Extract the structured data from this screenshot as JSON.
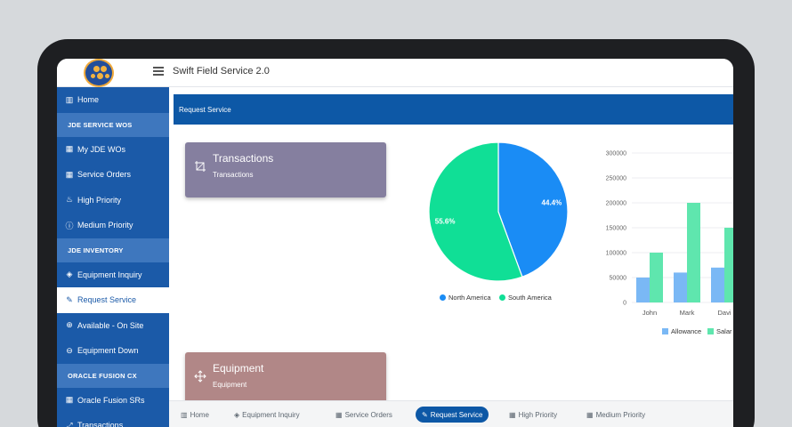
{
  "app": {
    "title": "Swift Field Service 2.0"
  },
  "sidebar": {
    "items": [
      {
        "type": "item",
        "label": "Home",
        "icon": "bar-chart-icon",
        "glyph": "▥"
      },
      {
        "type": "section",
        "label": "JDE SERVICE WOS"
      },
      {
        "type": "item",
        "label": "My JDE WOs",
        "icon": "grid-icon",
        "glyph": "▦"
      },
      {
        "type": "item",
        "label": "Service Orders",
        "icon": "grid-icon",
        "glyph": "▦"
      },
      {
        "type": "item",
        "label": "High Priority",
        "icon": "flame-icon",
        "glyph": "♨"
      },
      {
        "type": "item",
        "label": "Medium Priority",
        "icon": "alert-circle-icon",
        "glyph": "ⓘ"
      },
      {
        "type": "section",
        "label": "JDE INVENTORY"
      },
      {
        "type": "item",
        "label": "Equipment Inquiry",
        "icon": "layers-icon",
        "glyph": "◈"
      },
      {
        "type": "item",
        "label": "Request Service",
        "icon": "pencil-icon",
        "glyph": "✎",
        "active": true
      },
      {
        "type": "item",
        "label": "Available - On Site",
        "icon": "arrow-up-circle-icon",
        "glyph": "⊕"
      },
      {
        "type": "item",
        "label": "Equipment Down",
        "icon": "arrow-down-circle-icon",
        "glyph": "⊖"
      },
      {
        "type": "section",
        "label": "ORACLE FUSION CX"
      },
      {
        "type": "item",
        "label": "Oracle Fusion SRs",
        "icon": "grid-icon",
        "glyph": "▦"
      },
      {
        "type": "item",
        "label": "Transactions",
        "icon": "expand-icon",
        "glyph": "⤢"
      }
    ]
  },
  "content": {
    "header": "Request Service",
    "cards": [
      {
        "title": "Transactions",
        "subtitle": "Transactions",
        "color": "#857f9f",
        "icon": "crop-icon"
      },
      {
        "title": "Equipment",
        "subtitle": "Equipment",
        "color": "#b18787",
        "icon": "move-icon"
      }
    ]
  },
  "chart_data": [
    {
      "type": "pie",
      "slices": [
        {
          "label": "North America",
          "value": 44.4,
          "color": "#1a8cf5",
          "display": "44.4%"
        },
        {
          "label": "South America",
          "value": 55.6,
          "color": "#10df96",
          "display": "55.6%"
        }
      ],
      "legend": "bottom"
    },
    {
      "type": "bar",
      "categories": [
        "John",
        "Mark",
        "Davi"
      ],
      "series": [
        {
          "name": "Allowance",
          "values": [
            50000,
            60000,
            70000
          ],
          "color": "#7ab8f5"
        },
        {
          "name": "Salar",
          "values": [
            100000,
            200000,
            150000
          ],
          "color": "#5fe6ae"
        }
      ],
      "ylim": [
        0,
        300000
      ],
      "yticks": [
        "0",
        "50000",
        "100000",
        "150000",
        "200000",
        "250000",
        "300000"
      ],
      "grid": true,
      "legend": "bottom"
    }
  ],
  "bottomnav": {
    "items": [
      {
        "label": "Home",
        "glyph": "▥",
        "icon": "bar-chart-icon"
      },
      {
        "label": "Equipment Inquiry",
        "glyph": "◈",
        "icon": "layers-icon"
      },
      {
        "label": "Service Orders",
        "glyph": "▦",
        "icon": "grid-icon"
      },
      {
        "label": "Request Service",
        "glyph": "✎",
        "icon": "pencil-icon",
        "active": true
      },
      {
        "label": "High Priority",
        "glyph": "▦",
        "icon": "grid-icon"
      },
      {
        "label": "Medium Priority",
        "glyph": "▦",
        "icon": "grid-icon"
      }
    ]
  }
}
